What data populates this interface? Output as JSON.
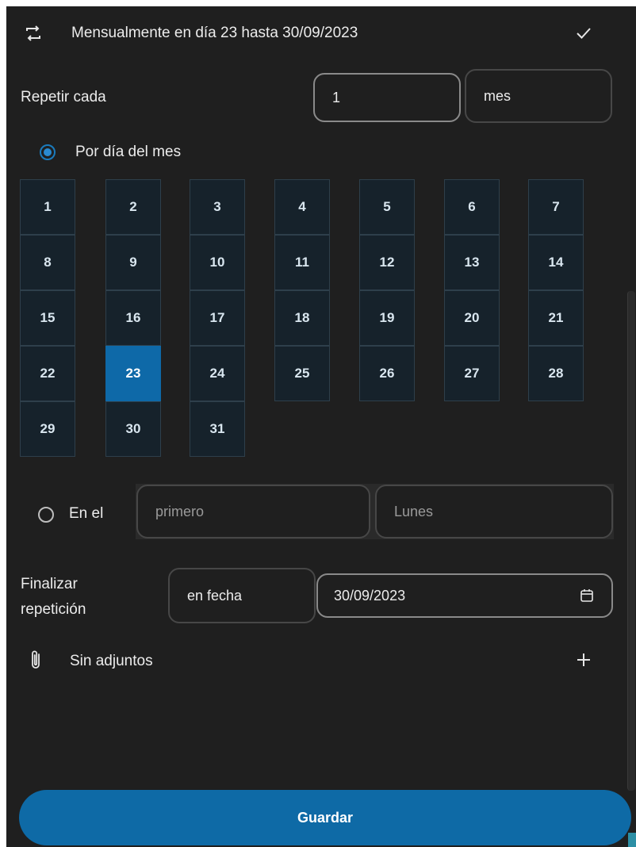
{
  "header": {
    "icon": "repeat-icon",
    "title": "Mensualmente en día 23 hasta 30/09/2023",
    "confirm_icon": "check-icon"
  },
  "repeat_every": {
    "label": "Repetir cada",
    "value": "1",
    "unit": "mes"
  },
  "by_day_of_month": {
    "label": "Por día del mes",
    "checked": true,
    "days": [
      "1",
      "2",
      "3",
      "4",
      "5",
      "6",
      "7",
      "8",
      "9",
      "10",
      "11",
      "12",
      "13",
      "14",
      "15",
      "16",
      "17",
      "18",
      "19",
      "20",
      "21",
      "22",
      "23",
      "24",
      "25",
      "26",
      "27",
      "28",
      "29",
      "30",
      "31"
    ],
    "selected_day": "23"
  },
  "on_the": {
    "label": "En el",
    "checked": false,
    "ordinal_placeholder": "primero",
    "weekday_placeholder": "Lunes"
  },
  "end_repeat": {
    "label_line1": "Finalizar",
    "label_line2": "repetición",
    "mode": "en fecha",
    "date": "30/09/2023",
    "date_icon": "calendar-icon"
  },
  "attachments": {
    "icon": "paperclip-icon",
    "label": "Sin adjuntos",
    "add_icon": "plus-icon"
  },
  "save_label": "Guardar",
  "colors": {
    "background": "#1f1f1f",
    "accent": "#0e6aa6",
    "day_tile": "#16222b",
    "selected_day": "#0e69a8"
  }
}
